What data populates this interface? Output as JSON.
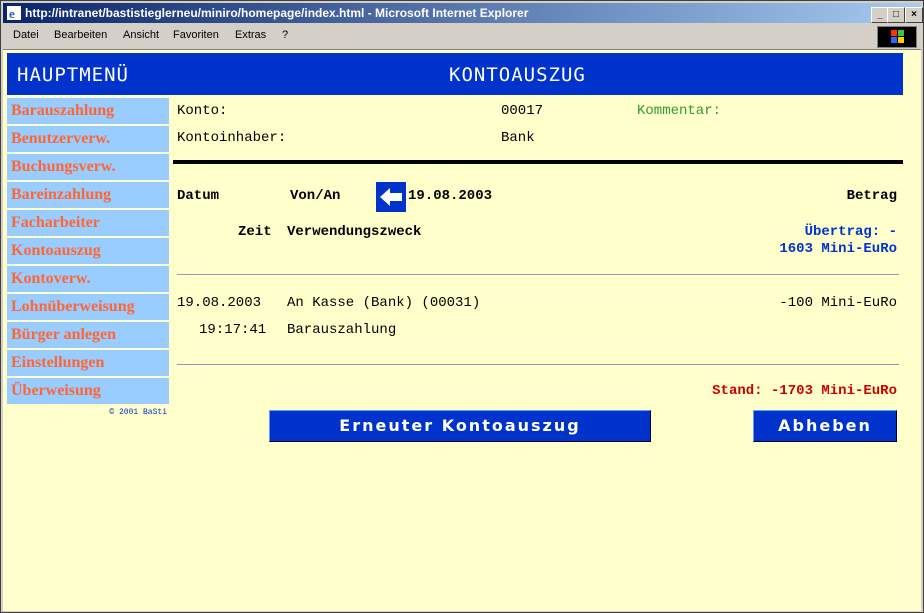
{
  "window": {
    "title": "http://intranet/bastistieglerneu/miniro/homepage/index.html - Microsoft Internet Explorer",
    "controls": {
      "minimize": "_",
      "maximize": "□",
      "close": "×"
    }
  },
  "menubar": [
    "Datei",
    "Bearbeiten",
    "Ansicht",
    "Favoriten",
    "Extras",
    "?"
  ],
  "header": {
    "menu_title": "HAUPTMENÜ",
    "page_title": "KONTOAUSZUG"
  },
  "sidebar": {
    "items": [
      "Barauszahlung",
      "Benutzerverw.",
      "Buchungsverw.",
      "Bareinzahlung",
      "Facharbeiter",
      "Kontoauszug",
      "Kontoverw.",
      "Lohnüberweisung",
      "Bürger anlegen",
      "Einstellungen",
      "Überweisung"
    ],
    "copyright": "© 2001 BaSti"
  },
  "account": {
    "konto_label": "Konto:",
    "konto_value": "00017",
    "kommentar_label": "Kommentar:",
    "inhaber_label": "Kontoinhaber:",
    "inhaber_value": "Bank"
  },
  "statement": {
    "col_datum": "Datum",
    "col_vonan": "Von/An",
    "date": "19.08.2003",
    "col_betrag": "Betrag",
    "col_zeit": "Zeit",
    "col_zweck": "Verwendungszweck",
    "uebertrag_line1": "Übertrag: -",
    "uebertrag_line2": "1603 Mini-EuRo",
    "entries": [
      {
        "date": "19.08.2003",
        "party": "An Kasse (Bank) (00031)",
        "amount": "-100 Mini-EuRo",
        "time": "19:17:41",
        "purpose": "Barauszahlung"
      }
    ],
    "stand": "Stand: -1703 Mini-EuRo"
  },
  "buttons": {
    "refresh": "Erneuter Kontoauszug",
    "withdraw": "Abheben"
  },
  "colors": {
    "header_blue": "#0033cc",
    "nav_bg": "#99ccff",
    "nav_text": "#ff6633",
    "page_bg": "#ffffcc",
    "stand_red": "#cc0000",
    "comment_green": "#339933"
  },
  "icons": {
    "back": "arrow-left-icon",
    "browser": "ie-icon",
    "windows": "windows-logo-icon"
  }
}
